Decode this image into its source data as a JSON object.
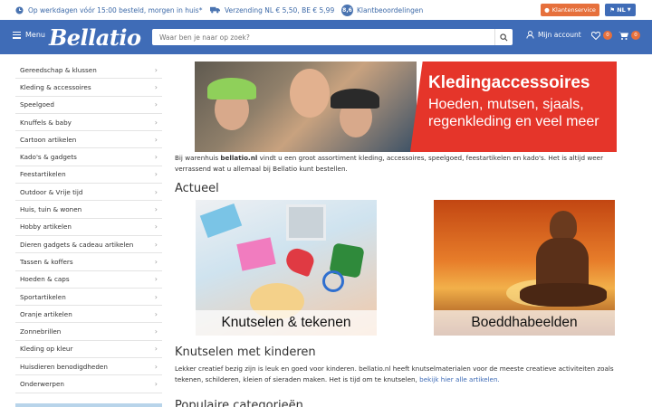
{
  "topbar": {
    "usp1": "Op werkdagen vóór 15:00 besteld, morgen in huis*",
    "usp2": "Verzending NL € 5,50, BE € 5,99",
    "rating": "8,6",
    "usp3": "Klantbeoordelingen",
    "service_label": "Klantenservice",
    "lang_label": "NL"
  },
  "header": {
    "menu_label": "Menu",
    "logo_text": "Bellatio",
    "search_placeholder": "Waar ben je naar op zoek?",
    "account_label": "Mijn account",
    "wishlist_count": "0",
    "cart_count": "0"
  },
  "sidebar": {
    "items": [
      "Gereedschap & klussen",
      "Kleding & accessoires",
      "Speelgoed",
      "Knuffels & baby",
      "Cartoon artikelen",
      "Kado's & gadgets",
      "Feestartikelen",
      "Outdoor & Vrije tijd",
      "Huis, tuin & wonen",
      "Hobby artikelen",
      "Dieren gadgets & cadeau artikelen",
      "Tassen & koffers",
      "Hoeden & caps",
      "Sportartikelen",
      "Oranje artikelen",
      "Zonnebrillen",
      "Kleding op kleur",
      "Huisdieren benodigdheden",
      "Onderwerpen"
    ]
  },
  "hero": {
    "title": "Kledingaccessoires",
    "subtitle": "Hoeden, mutsen, sjaals, regenkleding en veel meer"
  },
  "intro": {
    "before": "Bij warenhuis ",
    "brand": "bellatio.nl",
    "after": " vindt u een groot assortiment kleding, accessoires, speelgoed, feestartikelen en kado's. Het is altijd weer verrassend wat u allemaal bij Bellatio kunt bestellen."
  },
  "actueel": {
    "heading": "Actueel",
    "tile1": "Knutselen & tekenen",
    "tile2": "Boeddhabeelden"
  },
  "knutselen": {
    "heading": "Knutselen met kinderen",
    "text": "Lekker creatief bezig zijn is leuk en goed voor kinderen. bellatio.nl heeft knutselmaterialen voor de meeste creatieve activiteiten zoals tekenen, schilderen, kleien of sieraden maken. Het is tijd om te knutselen, ",
    "link": "bekijk hier alle artikelen."
  },
  "populaire": {
    "heading": "Populaire categorieën"
  },
  "colors": {
    "brand_blue": "#3f6cb7",
    "accent_orange": "#e6703c",
    "hero_red": "#e5352a"
  }
}
